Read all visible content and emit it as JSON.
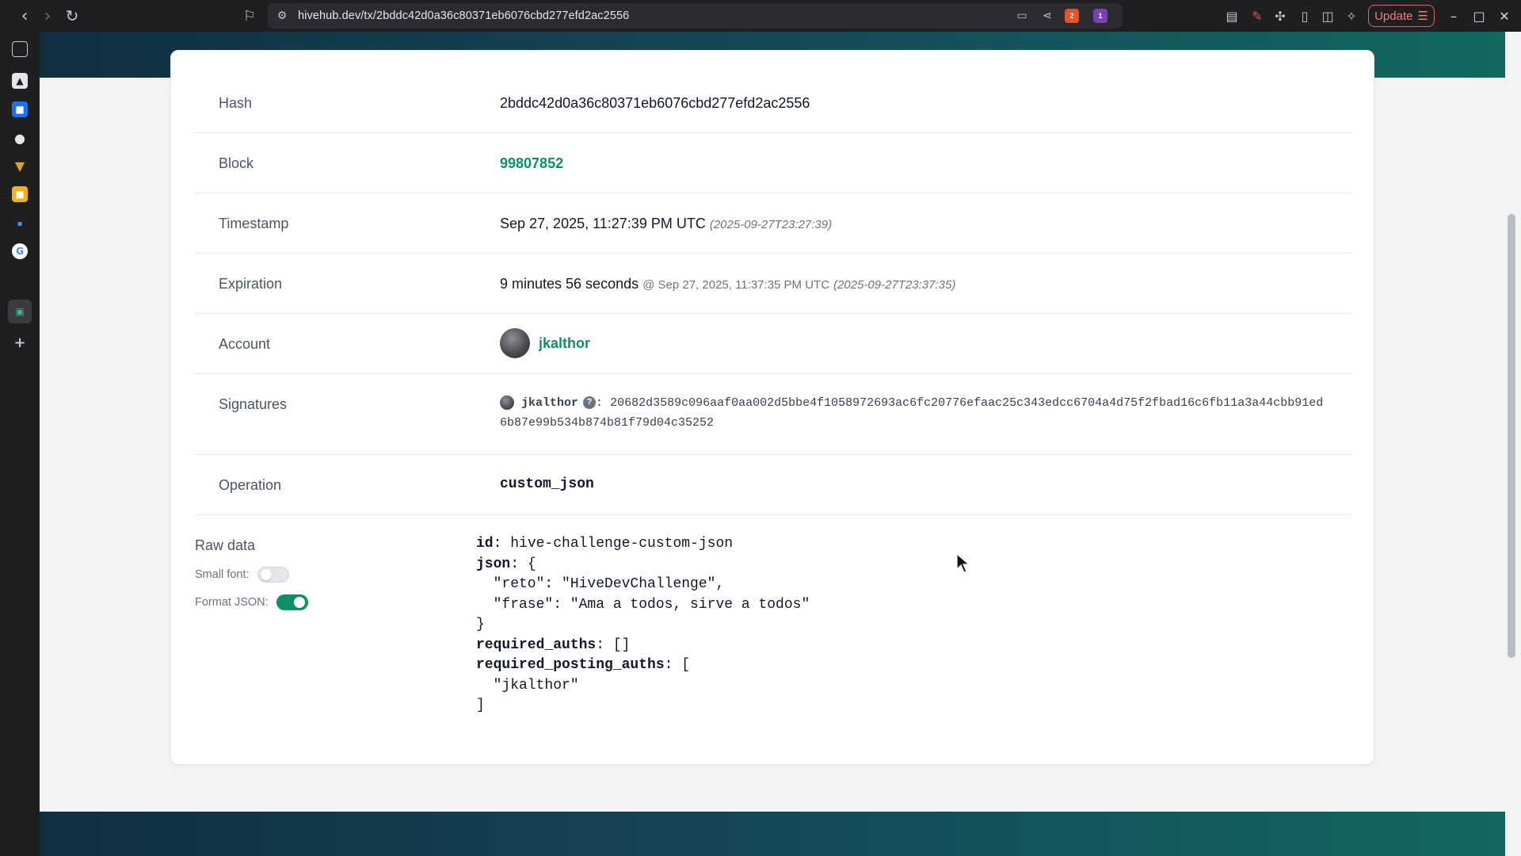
{
  "browser": {
    "url": "hivehub.dev/tx/2bddc42d0a36c80371eb6076cbd277efd2ac2556",
    "update_label": "Update",
    "shield_count": "2",
    "alert_count": "1"
  },
  "tx": {
    "rows": {
      "hash": {
        "label": "Hash",
        "value": "2bddc42d0a36c80371eb6076cbd277efd2ac2556"
      },
      "block": {
        "label": "Block",
        "value": "99807852"
      },
      "timestamp": {
        "label": "Timestamp",
        "value": "Sep 27, 2025, 11:27:39 PM UTC",
        "iso": "(2025-09-27T23:27:39)"
      },
      "expiration": {
        "label": "Expiration",
        "value": "9 minutes 56 seconds",
        "at": "@ Sep 27, 2025, 11:37:35 PM UTC",
        "iso": "(2025-09-27T23:37:35)"
      },
      "account": {
        "label": "Account",
        "value": "jkalthor"
      },
      "signatures": {
        "label": "Signatures",
        "signer": "jkalthor",
        "help": "?",
        "colon": ":",
        "value": "20682d3589c096aaf0aa002d5bbe4f1058972693ac6fc20776efaac25c343edcc6704a4d75f2fbad16c6fb11a3a44cbb91ed6b87e99b534b874b81f79d04c35252"
      },
      "operation": {
        "label": "Operation",
        "value": "custom_json"
      },
      "raw": {
        "label": "Raw data",
        "small_font_label": "Small font:",
        "small_font_on": false,
        "format_json_label": "Format JSON:",
        "format_json_on": true,
        "id_key": "id",
        "id_value": "hive-challenge-custom-json",
        "json_key": "json",
        "json_open": "{",
        "json_line1": "  \"reto\": \"HiveDevChallenge\",",
        "json_line2": "  \"frase\": \"Ama a todos, sirve a todos\"",
        "json_close": "}",
        "required_auths_key": "required_auths",
        "required_auths_value": "[]",
        "required_posting_auths_key": "required_posting_auths",
        "rpa_open": "[",
        "rpa_line1": "  \"jkalthor\"",
        "rpa_close": "]"
      }
    }
  },
  "colors": {
    "accent": "#0e8f67",
    "hero": "#15485a"
  }
}
